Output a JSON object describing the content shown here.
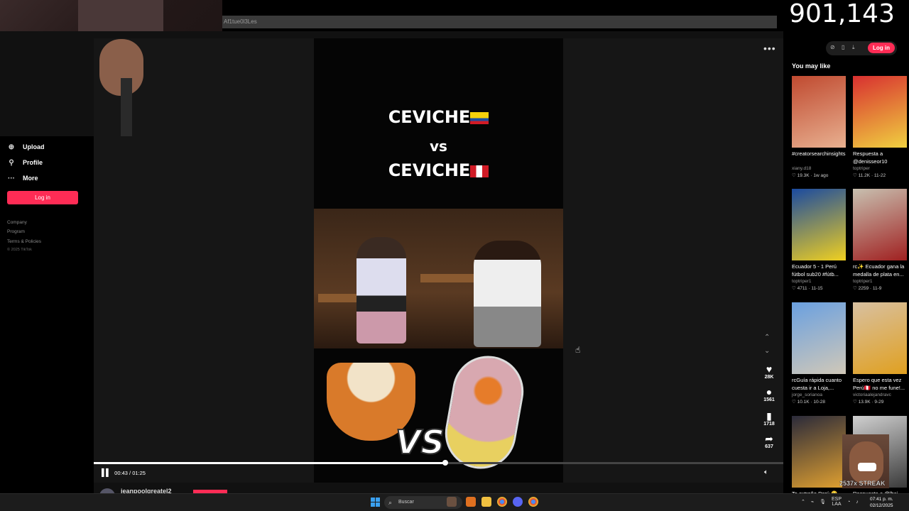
{
  "overlay": {
    "counter": "901,143",
    "streak": "2537x STREAK"
  },
  "browser": {
    "url_fragment": "Af1tue0l3Les"
  },
  "sidebar": {
    "items": [
      {
        "label": "Upload",
        "icon": "upload-icon"
      },
      {
        "label": "Profile",
        "icon": "profile-icon"
      },
      {
        "label": "More",
        "icon": "more-icon"
      }
    ],
    "login_label": "Log in",
    "footer": [
      "Company",
      "Program",
      "Terms & Policies",
      "© 2025 TikTok"
    ]
  },
  "video": {
    "title_line1": "CEVICHE",
    "title_vs": "vs",
    "title_line2": "CEVICHE",
    "overlay_vs": "VS",
    "current_time": "00:43 / 01:25",
    "progress": 0.51,
    "actions": [
      {
        "icon": "heart-icon",
        "glyph": "♥",
        "count": "28K"
      },
      {
        "icon": "comment-icon",
        "glyph": "●",
        "count": "1561"
      },
      {
        "icon": "bookmark-icon",
        "glyph": "▮",
        "count": "1718"
      },
      {
        "icon": "share-icon",
        "glyph": "➦",
        "count": "637"
      }
    ],
    "author": "jeanpoolgreatel2"
  },
  "right": {
    "login_label": "Log in",
    "you_may_like": "You may like",
    "cards": [
      {
        "caption": "#creatorsearchinsights...",
        "author": "xiany.d18",
        "stats": "♡ 19.3K · 1w ago",
        "color1": "#c04a30",
        "color2": "#e8b090"
      },
      {
        "caption": "Respuesta a @denisseor10",
        "author": "toptriper",
        "stats": "♡ 11.2K · 11-22",
        "color1": "#d83030",
        "color2": "#f0d040"
      },
      {
        "caption": "Ecuador 5 - 1 Perú fútbol sub20 #fútb...",
        "author": "toptriper1",
        "stats": "♡ 4711 · 11-15",
        "color1": "#1a4aa0",
        "color2": "#f0d020"
      },
      {
        "caption": "rc✨ Ecuador gana la medalla de plata en...",
        "author": "toptriper1",
        "stats": "♡ 2259 · 11-9",
        "color1": "#c8c0b0",
        "color2": "#a02020"
      },
      {
        "caption": "rcGuía rápida cuanto cuesta ir a Loja,...",
        "author": "jorge_sorianoa",
        "stats": "♡ 10.1K · 10-28",
        "color1": "#6aa0e0",
        "color2": "#d0c8b8"
      },
      {
        "caption": "Espero que esta vez Perú🇵🇪 no me fune!...",
        "author": "victoriaalejandravc",
        "stats": "♡ 13.9K · 9-29",
        "color1": "#d8c0a0",
        "color2": "#e0a020"
      },
      {
        "caption": "Te extraño Perú 🥺",
        "author": "",
        "stats": "",
        "color1": "#2a2a3a",
        "color2": "#e0a030"
      },
      {
        "caption": "Respuesta a @lbai...",
        "author": "",
        "stats": "",
        "color1": "#d0d0d0",
        "color2": "#3a3a3a"
      }
    ]
  },
  "taskbar": {
    "search_placeholder": "Buscar",
    "lang": "ESP",
    "lang2": "LAA",
    "time": "07:41 p. m.",
    "date": "02/12/2025"
  }
}
